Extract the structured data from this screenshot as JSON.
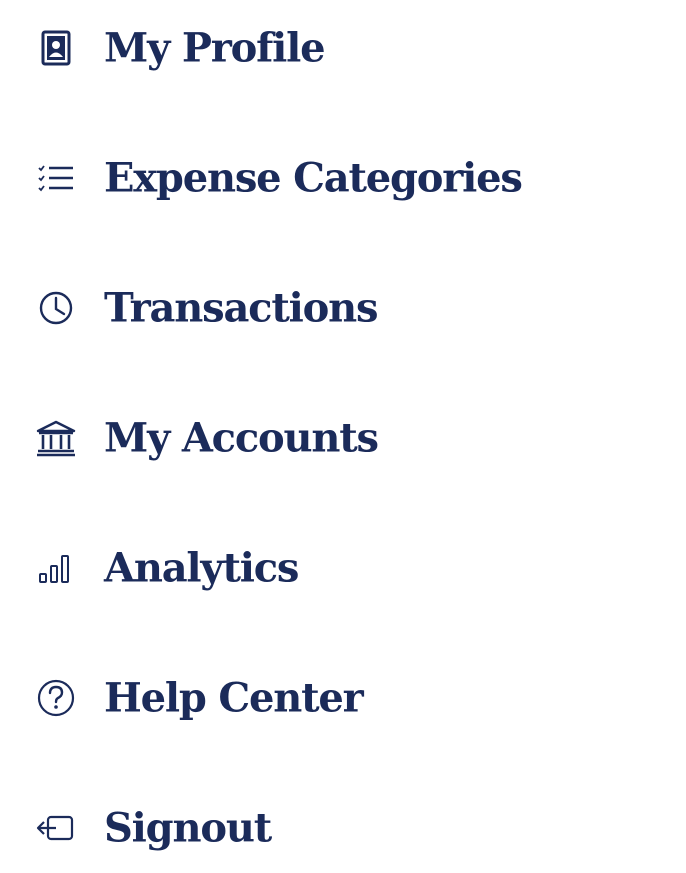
{
  "menu": {
    "items": [
      {
        "label": "My Profile",
        "icon": "profile-badge-icon"
      },
      {
        "label": "Expense Categories",
        "icon": "list-icon"
      },
      {
        "label": "Transactions",
        "icon": "clock-icon"
      },
      {
        "label": "My Accounts",
        "icon": "bank-icon"
      },
      {
        "label": "Analytics",
        "icon": "bar-chart-icon"
      },
      {
        "label": "Help Center",
        "icon": "help-circle-icon"
      },
      {
        "label": "Signout",
        "icon": "signout-icon"
      }
    ]
  },
  "colors": {
    "text": "#1b2b5a",
    "background": "#ffffff"
  }
}
